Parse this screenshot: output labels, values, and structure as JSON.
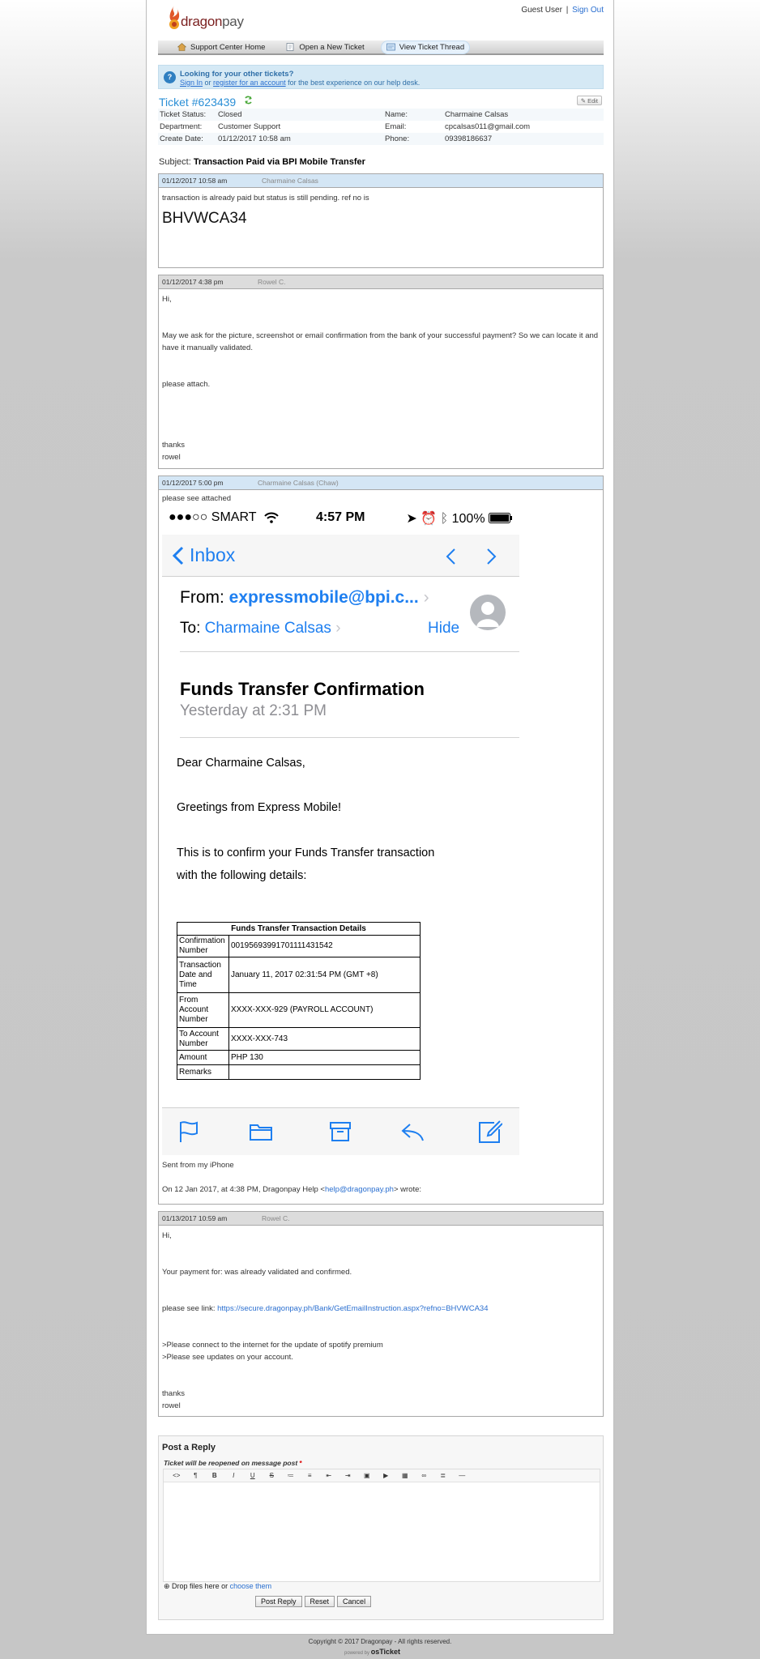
{
  "header": {
    "logo_text_dragon": "dragon",
    "logo_text_pay": "pay",
    "guest_user": "Guest User",
    "separator": "|",
    "sign_out": "Sign Out"
  },
  "nav": {
    "items": [
      {
        "label": "Support Center Home",
        "icon": "home-icon"
      },
      {
        "label": "Open a New Ticket",
        "icon": "new-ticket-icon"
      },
      {
        "label": "View Ticket Thread",
        "icon": "ticket-thread-icon"
      }
    ]
  },
  "notice": {
    "title": "Looking for your other tickets?",
    "sign_in": "Sign In",
    "or": " or ",
    "register": "register for an account",
    "rest": " for the best experience on our help desk."
  },
  "ticket": {
    "title": "Ticket #623439",
    "edit_label": "Edit",
    "fields": {
      "status_label": "Ticket Status:",
      "status": "Closed",
      "department_label": "Department:",
      "department": "Customer Support",
      "created_label": "Create Date:",
      "created": "01/12/2017 10:58 am",
      "name_label": "Name:",
      "name": "Charmaine Calsas",
      "email_label": "Email:",
      "email": "cpcalsas011@gmail.com",
      "phone_label": "Phone:",
      "phone": "09398186637"
    },
    "subject_label": "Subject:",
    "subject": "Transaction Paid via BPI Mobile Transfer"
  },
  "thread": [
    {
      "date": "01/12/2017 10:58 am",
      "author": "Charmaine Calsas",
      "line1": "transaction is already paid but status is still pending. ref no is",
      "ref": "BHVWCA34"
    },
    {
      "date": "01/12/2017 4:38 pm",
      "author": "Rowel C.",
      "hi": "Hi,",
      "p1": "May we ask for the picture, screenshot or email confirmation from the bank of your successful payment? So we can locate it and have it manually validated.",
      "p2": "please attach.",
      "thanks": "thanks",
      "sig": "rowel"
    },
    {
      "date": "01/12/2017 5:00 pm",
      "author": "Charmaine Calsas (Chaw)",
      "line1": "please see attached",
      "sent": "Sent from my iPhone",
      "quote_prefix": "On 12 Jan 2017, at 4:38 PM, Dragonpay Help <",
      "quote_email": "help@dragonpay.ph",
      "quote_suffix": "> wrote:"
    },
    {
      "date": "01/13/2017 10:59 am",
      "author": "Rowel C.",
      "hi": "Hi,",
      "p1": "Your payment for: was already validated and confirmed.",
      "link_prefix": "please see link: ",
      "link": "https://secure.dragonpay.ph/Bank/GetEmailInstruction.aspx?refno=BHVWCA34",
      "u1": ">Please connect to the internet for the update of spotify premium",
      "u2": ">Please see updates on your account.",
      "thanks": "thanks",
      "sig": "rowel"
    }
  ],
  "phone": {
    "carrier": "●●●○○ SMART",
    "time": "4:57 PM",
    "battery": "100%",
    "back_label": "Inbox",
    "from_label": "From:",
    "from": "expressmobile@bpi.c...",
    "to_label": "To:",
    "to": "Charmaine Calsas",
    "hide": "Hide",
    "subject": "Funds Transfer Confirmation",
    "date": "Yesterday at 2:31 PM",
    "greeting": "Dear Charmaine Calsas,",
    "greet2": "Greetings from Express Mobile!",
    "confirm1": "This is to confirm your Funds Transfer transaction",
    "confirm2": "with the following details:",
    "table_title": "Funds Transfer Transaction Details",
    "rows": [
      {
        "k": "Confirmation Number",
        "v": "00195693991701111431542"
      },
      {
        "k": "Transaction Date and Time",
        "v": "January 11, 2017 02:31:54 PM (GMT +8)"
      },
      {
        "k": "From Account Number",
        "v": "XXXX-XXX-929 (PAYROLL ACCOUNT)"
      },
      {
        "k": "To Account Number",
        "v": "XXXX-XXX-743"
      },
      {
        "k": "Amount",
        "v": "PHP 130"
      },
      {
        "k": "Remarks",
        "v": ""
      }
    ]
  },
  "reply": {
    "title": "Post a Reply",
    "note": "Ticket will be reopened on message post",
    "req": "*",
    "toolbar": [
      "<>",
      "¶",
      "B",
      "I",
      "U",
      "S",
      "≔",
      "≡",
      "⇤",
      "⇥",
      "▣",
      "▶",
      "▦",
      "∞",
      "≣",
      "—"
    ],
    "drop_prefix": "Drop files here or ",
    "choose": "choose them",
    "post": "Post Reply",
    "reset": "Reset",
    "cancel": "Cancel"
  },
  "footer": {
    "copyright": "Copyright © 2017 Dragonpay - All rights reserved.",
    "powered_by": "powered by",
    "brand": "osTicket"
  }
}
